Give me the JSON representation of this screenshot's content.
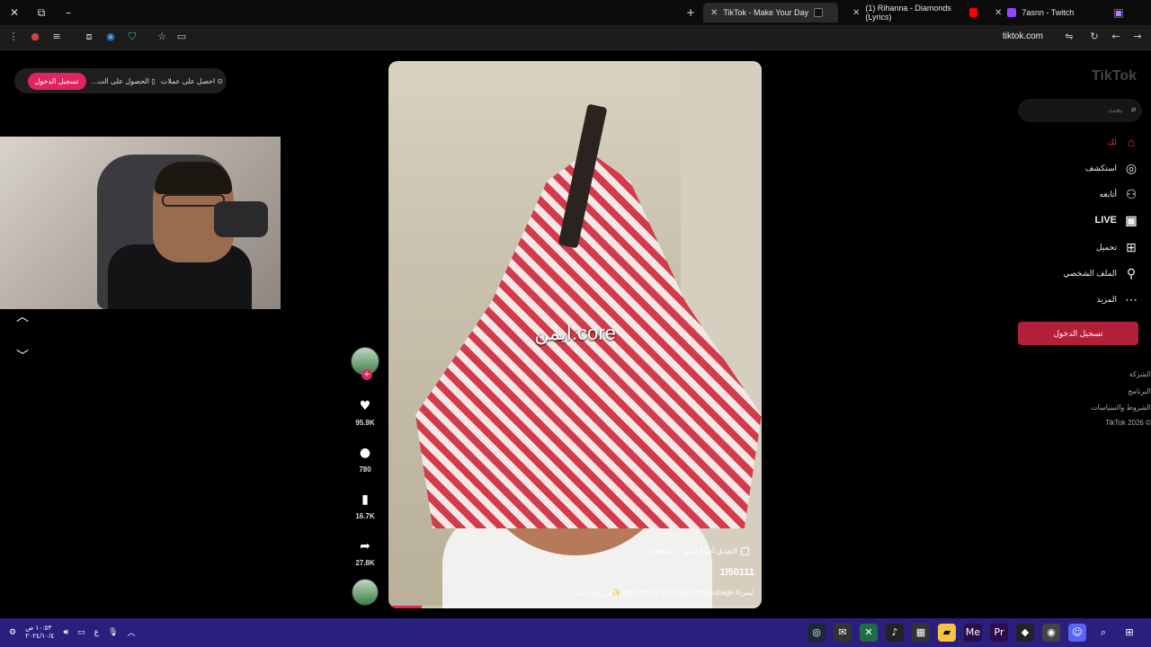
{
  "browser": {
    "tabs": [
      {
        "title": "TikTok - Make Your Day",
        "active": true,
        "favicon_color": "#111111"
      },
      {
        "title": "(1) Rihanna - Diamonds (Lyrics)",
        "active": false,
        "favicon_color": "#ff0000"
      },
      {
        "title": "7asnn - Twitch",
        "active": false,
        "favicon_color": "#9146ff"
      }
    ],
    "url": "tiktok.com"
  },
  "topbar": {
    "login_label": "تسجيل الدخول",
    "get_app_label": "الحصول على الت...",
    "coins_label": "احصل على عملات"
  },
  "video": {
    "overlay_text": "ايمن:core",
    "capcut_label": "CapCut · التعديل أصبح أسهل",
    "username": "1l50111",
    "caption": "من تصاحب✨ #fyp #core #zxycba #foryoupage #ايمن",
    "progress": 0.09
  },
  "actions": {
    "likes": "95.9K",
    "comments": "780",
    "saves": "16.7K",
    "shares": "27.8K"
  },
  "sidebar": {
    "logo": "TikTok",
    "search_placeholder": "بحث",
    "items": [
      {
        "label": "لك",
        "icon": "home-icon"
      },
      {
        "label": "استكشف",
        "icon": "compass-icon"
      },
      {
        "label": "أتابعه",
        "icon": "following-icon"
      },
      {
        "label": "LIVE",
        "icon": "live-icon"
      },
      {
        "label": "تحميل",
        "icon": "upload-icon"
      },
      {
        "label": "الملف الشخصي",
        "icon": "profile-icon"
      },
      {
        "label": "المزيد",
        "icon": "more-icon"
      }
    ],
    "login_button": "تسجيل الدخول",
    "footer": [
      "الشركة",
      "البرنامج",
      "الشروط والسياسات",
      "© 2026 TikTok"
    ]
  },
  "taskbar": {
    "time": "١٠:٥٣ ص",
    "date": "٢٠٢٤/١٠/٤",
    "lang": "ع"
  },
  "colors": {
    "accent": "#fe2c55",
    "login": "#b31f3a",
    "taskbar": "#2b1f7d"
  }
}
